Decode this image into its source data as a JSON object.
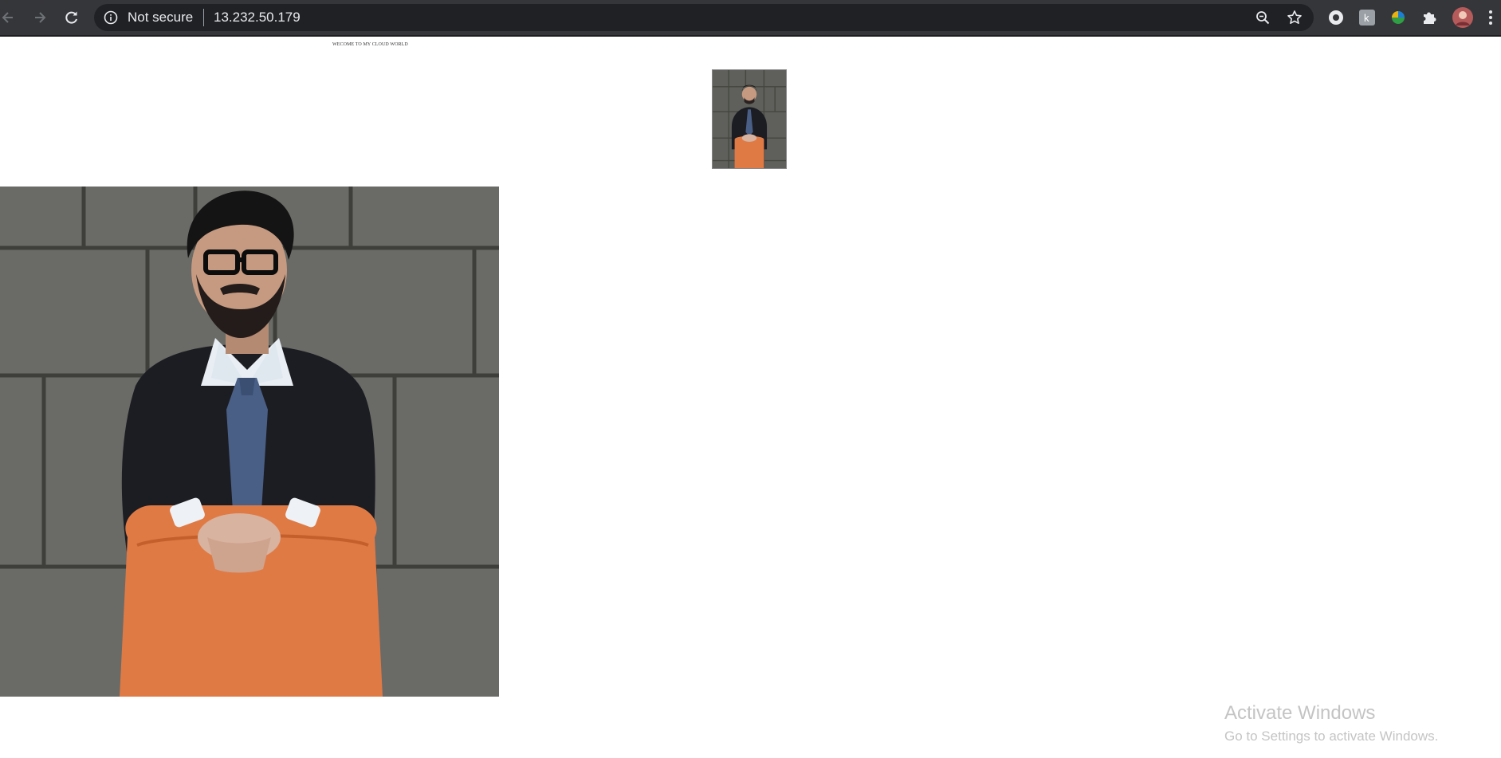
{
  "browser": {
    "security_label": "Not secure",
    "url": "13.232.50.179"
  },
  "page": {
    "welcome_text": "WECOME TO MY CLOUD WORLD"
  },
  "watermark": {
    "title": "Activate Windows",
    "subtitle": "Go to Settings to activate Windows."
  },
  "colors": {
    "chrome_bg": "#35363a",
    "omnibox_bg": "#202124",
    "chair": "#e07a45",
    "wall": "#5f605b",
    "jacket": "#1c1d22"
  }
}
